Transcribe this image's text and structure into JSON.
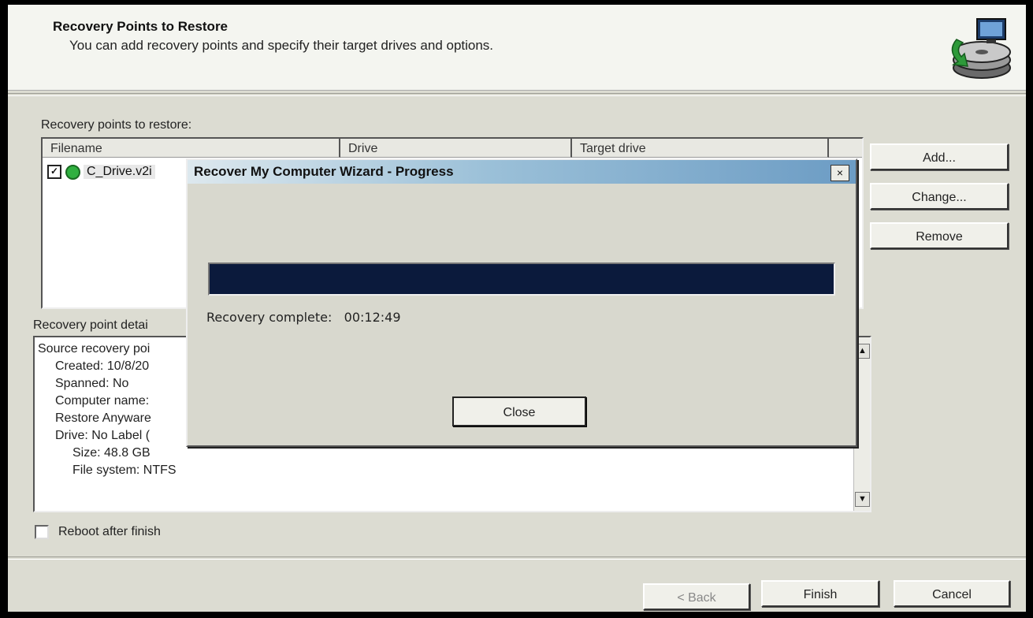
{
  "header": {
    "title": "Recovery Points to Restore",
    "subtitle": "You can add recovery points and specify their target drives and options."
  },
  "list": {
    "label": "Recovery points to restore:",
    "columns": [
      "Filename",
      "Drive",
      "Target drive"
    ],
    "rows": [
      {
        "filename": "C_Drive.v2i",
        "checked": true
      }
    ]
  },
  "side_buttons": {
    "add": "Add...",
    "change": "Change...",
    "remove": "Remove"
  },
  "details": {
    "label": "Recovery point detai",
    "lines": [
      "Source recovery poi",
      "Created:  10/8/20",
      "Spanned:  No",
      "Computer name:",
      "Restore Anyware",
      "Drive:  No Label (",
      "Size:  48.8 GB",
      "File system:  NTFS"
    ]
  },
  "reboot_label": "Reboot after finish",
  "footer": {
    "back": "< Back",
    "finish": "Finish",
    "cancel": "Cancel"
  },
  "dialog": {
    "title": "Recover My Computer Wizard - Progress",
    "close_x": "×",
    "progress": 1.0,
    "status_label": "Recovery complete:",
    "elapsed": "00:12:49",
    "close_button": "Close"
  },
  "colors": {
    "progress_fill": "#0b1a3c",
    "status_dot": "#30b040"
  },
  "icons": {
    "logo": "drive-restore-icon",
    "status": "green-dot-icon",
    "checkbox": "checkbox-icon"
  }
}
